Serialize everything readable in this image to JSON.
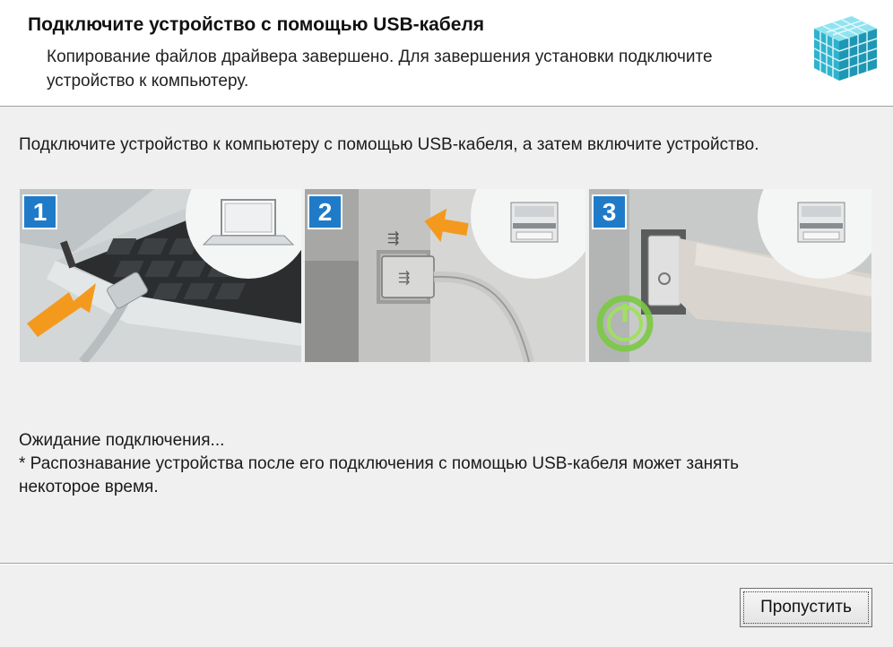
{
  "header": {
    "title": "Подключите устройство с помощью USB-кабеля",
    "subtitle": "Копирование файлов драйвера завершено. Для завершения установки подключите устройство к компьютеру."
  },
  "main": {
    "instruction": "Подключите устройство к компьютеру с помощью USB-кабеля, а затем включите устройство.",
    "steps": [
      {
        "number": "1",
        "icon": "laptop-usb-illustration"
      },
      {
        "number": "2",
        "icon": "printer-usb-port-illustration"
      },
      {
        "number": "3",
        "icon": "printer-power-switch-illustration"
      }
    ],
    "status_line": "Ожидание подключения...",
    "note_line1": "* Распознавание устройства после его подключения с помощью USB-кабеля может занять",
    "note_line2": "некоторое время."
  },
  "footer": {
    "skip_label": "Пропустить"
  },
  "colors": {
    "badge": "#1f7bc8",
    "arrow": "#f39a1e",
    "power": "#7ac943",
    "logo": "#3fbfd6"
  }
}
